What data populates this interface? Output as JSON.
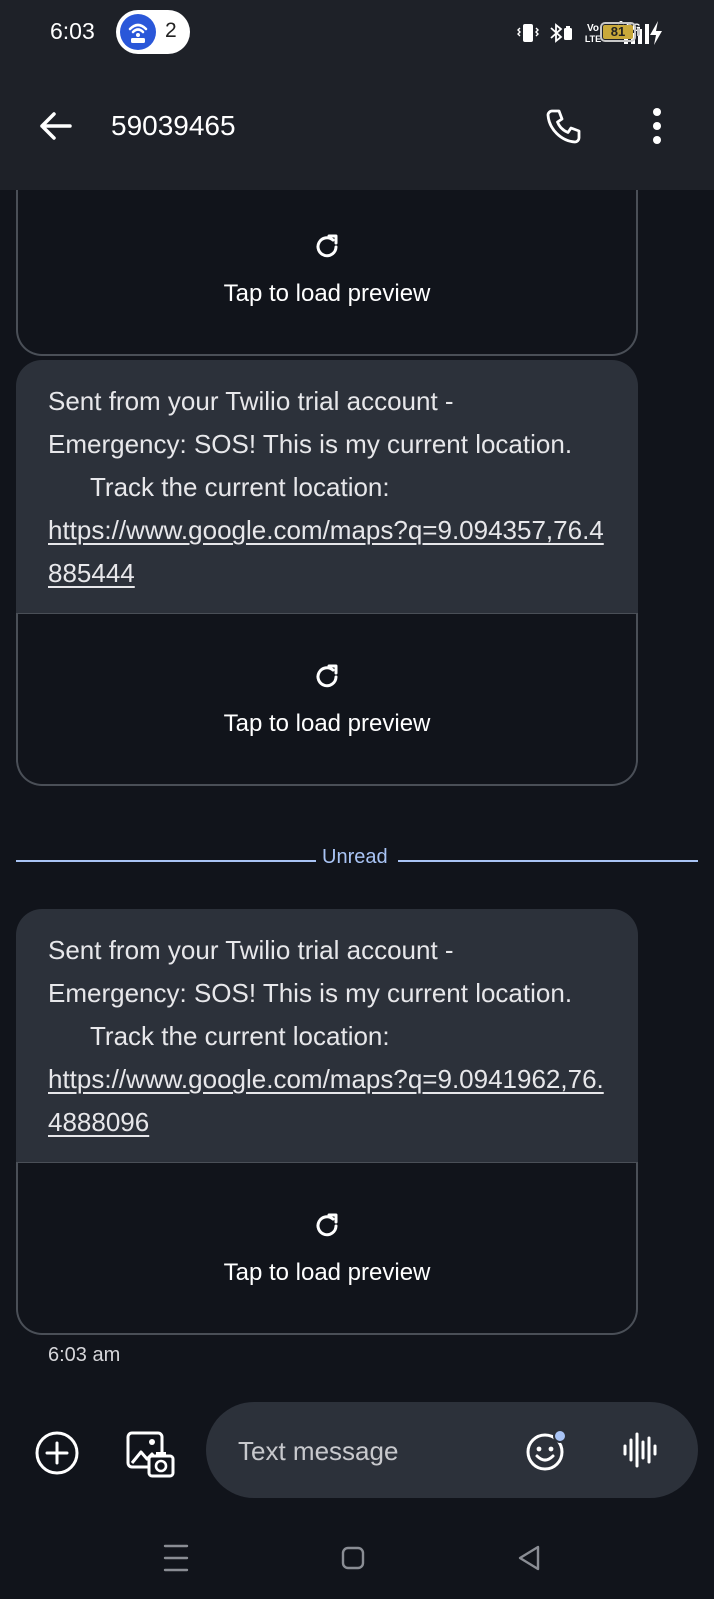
{
  "status_bar": {
    "time": "6:03",
    "hotspot_count": "2",
    "network": "5G",
    "volte": "Vo LTE",
    "battery": "81",
    "icons": [
      "wifi-hotspot-icon",
      "vibrate-icon",
      "bluetooth-icon",
      "volte-icon",
      "signal-5g-icon",
      "battery-icon",
      "charging-icon"
    ]
  },
  "header": {
    "title": "59039465",
    "icons": [
      "back-arrow-icon",
      "phone-call-icon",
      "more-vert-icon"
    ]
  },
  "messages": [
    {
      "preview_label": "Tap to load preview"
    },
    {
      "line1": "Sent from your Twilio trial account -",
      "line2": "Emergency: SOS! This is my current location.",
      "line3": "Track the current location:",
      "link": "https://www.google.com/maps?q=9.094357,76.4885444",
      "preview_label": "Tap to load preview"
    },
    {
      "line1": "Sent from your Twilio trial account -",
      "line2": "Emergency: SOS! This is my current location.",
      "line3": "Track the current location:",
      "link": "https://www.google.com/maps?q=9.0941962,76.4888096",
      "preview_label": "Tap to load preview",
      "timestamp": "6:03 am"
    }
  ],
  "unread_divider": "Unread",
  "composer": {
    "placeholder": "Text message",
    "icons": [
      "add-circle-icon",
      "gallery-icon",
      "emoji-icon",
      "voice-icon"
    ]
  },
  "nav_bar": {
    "icons": [
      "recent-apps-icon",
      "home-icon",
      "back-triangle-icon"
    ]
  },
  "colors": {
    "background": "#11141b",
    "bar": "#1e2128",
    "bubble": "#2c313a",
    "accent": "#a9c4f5",
    "hotspot": "#2a57d9"
  }
}
